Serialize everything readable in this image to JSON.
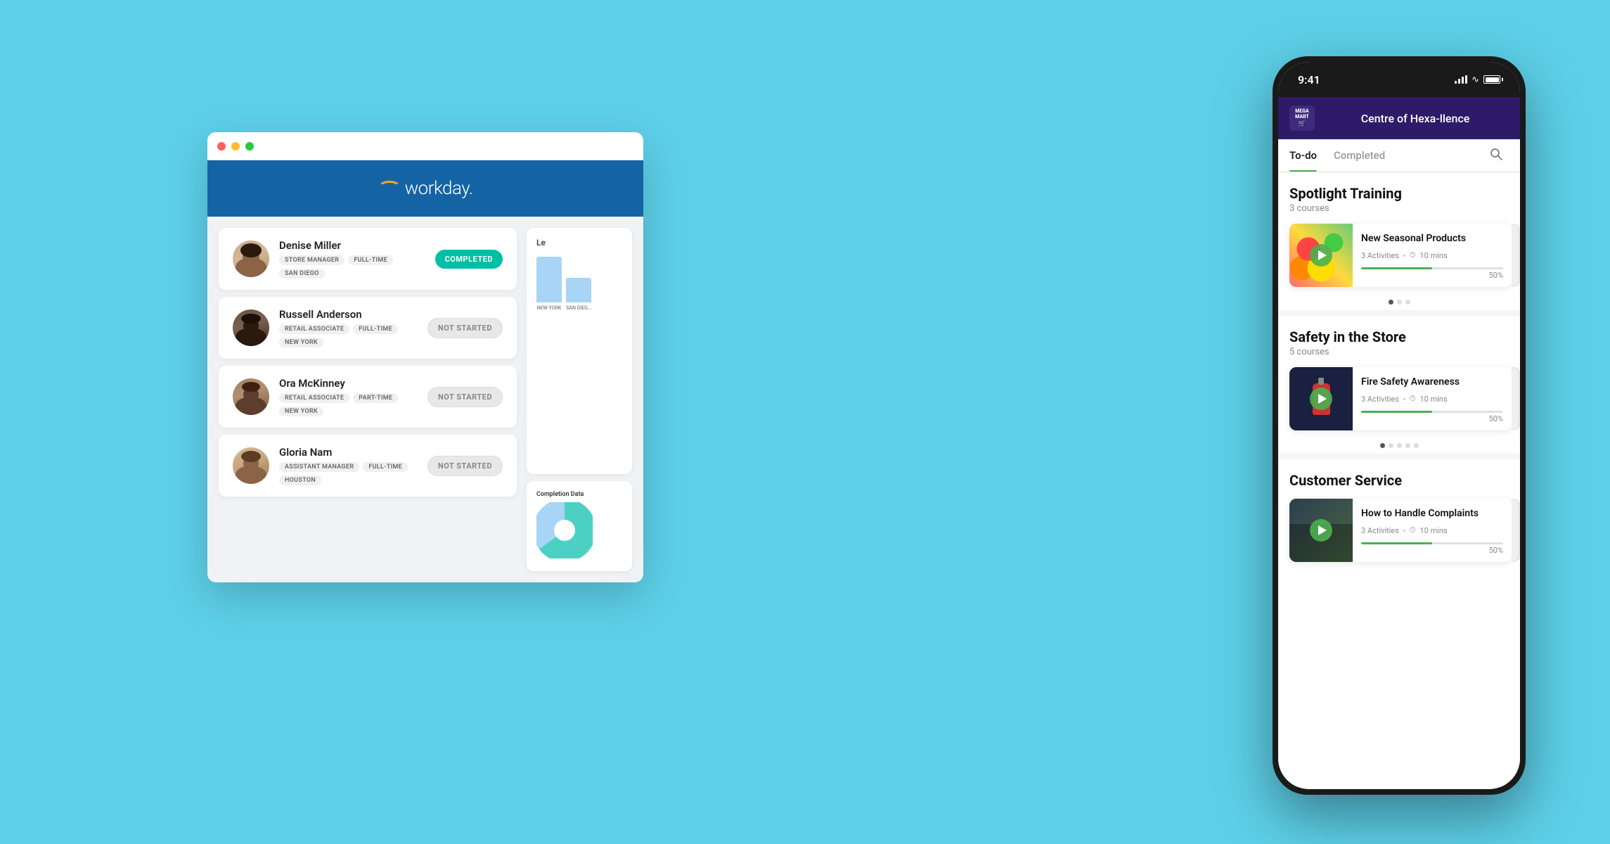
{
  "background": "#5dd0e8",
  "desktop": {
    "header": {
      "logo_text": "workday.",
      "bg_color": "#1464a5"
    },
    "employees": [
      {
        "name": "Denise Miller",
        "tags": [
          "STORE MANAGER",
          "FULL-TIME",
          "SAN DIEGO"
        ],
        "status": "COMPLETED",
        "status_type": "completed"
      },
      {
        "name": "Russell Anderson",
        "tags": [
          "RETAIL ASSOCIATE",
          "FULL-TIME",
          "NEW YORK"
        ],
        "status": "NOT STARTED",
        "status_type": "not-started"
      },
      {
        "name": "Ora McKinney",
        "tags": [
          "RETAIL ASSOCIATE",
          "PART-TIME",
          "NEW YORK"
        ],
        "status": "NOT STARTED",
        "status_type": "not-started"
      },
      {
        "name": "Gloria Nam",
        "tags": [
          "ASSISTANT MANAGER",
          "FULL-TIME",
          "HOUSTON"
        ],
        "status": "NOT STARTED",
        "status_type": "not-started"
      }
    ],
    "chart": {
      "title": "Le",
      "bars": [
        {
          "label": "NEW YORK",
          "height": 65
        },
        {
          "label": "SAN DIEG...",
          "height": 35
        }
      ]
    },
    "pie_label": "Completion Data"
  },
  "mobile": {
    "status_bar": {
      "time": "9:41"
    },
    "app_header": {
      "logo_line1": "MEGA",
      "logo_line2": "MART",
      "title": "Centre of Hexa-llence"
    },
    "tabs": {
      "todo": "To-do",
      "completed": "Completed",
      "active": "todo"
    },
    "sections": [
      {
        "title": "Spotlight Training",
        "subtitle": "3 courses",
        "courses": [
          {
            "name": "New Seasonal Products",
            "activities": "3 Activities",
            "duration": "10 mins",
            "progress": 50,
            "thumb_type": "seasonal",
            "dots": 3,
            "active_dot": 0
          }
        ]
      },
      {
        "title": "Safety in the Store",
        "subtitle": "5 courses",
        "courses": [
          {
            "name": "Fire Safety Awareness",
            "activities": "3 Activities",
            "duration": "10 mins",
            "progress": 50,
            "thumb_type": "fire",
            "dots": 5,
            "active_dot": 0
          }
        ]
      },
      {
        "title": "Customer Service",
        "subtitle": "",
        "courses": [
          {
            "name": "How to Handle Complaints",
            "activities": "3 Activities",
            "duration": "10 mins",
            "progress": 50,
            "thumb_type": "customer",
            "dots": 0,
            "active_dot": 0
          }
        ]
      }
    ]
  }
}
